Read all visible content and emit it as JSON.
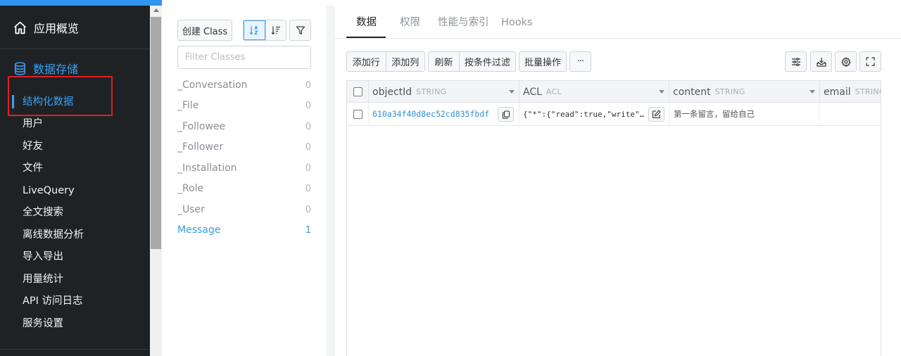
{
  "sidebar": {
    "header": {
      "label": "应用概览",
      "icon": "home-icon"
    },
    "section": {
      "label": "数据存储",
      "icon": "database-icon"
    },
    "items": [
      {
        "label": "结构化数据",
        "active": true
      },
      {
        "label": "用户"
      },
      {
        "label": "好友"
      },
      {
        "label": "文件"
      },
      {
        "label": "LiveQuery"
      },
      {
        "label": "全文搜索"
      },
      {
        "label": "离线数据分析"
      },
      {
        "label": "导入导出"
      },
      {
        "label": "用量统计"
      },
      {
        "label": "API 访问日志"
      },
      {
        "label": "服务设置"
      }
    ],
    "accent_color": "#3aa0f2",
    "highlight_color": "#e02020"
  },
  "class_panel": {
    "create_label": "创建 Class",
    "sort_asc_icon": "sort-alpha-icon",
    "sort_desc_icon": "sort-desc-icon",
    "filter_icon": "funnel-icon",
    "filter_placeholder": "Filter Classes",
    "classes": [
      {
        "name": "_Conversation",
        "count": "0"
      },
      {
        "name": "_File",
        "count": "0"
      },
      {
        "name": "_Followee",
        "count": "0"
      },
      {
        "name": "_Follower",
        "count": "0"
      },
      {
        "name": "_Installation",
        "count": "0"
      },
      {
        "name": "_Role",
        "count": "0"
      },
      {
        "name": "_User",
        "count": "0"
      },
      {
        "name": "Message",
        "count": "1",
        "selected": true
      }
    ]
  },
  "tabs": [
    {
      "label": "数据",
      "active": true
    },
    {
      "label": "权限"
    },
    {
      "label": "性能与索引"
    },
    {
      "label": "Hooks"
    }
  ],
  "toolbar": {
    "add_row": "添加行",
    "add_column": "添加列",
    "refresh": "刷新",
    "filter_by_condition": "按条件过滤",
    "batch_ops": "批量操作",
    "more": "···",
    "right_icons": [
      "columns-settings-icon",
      "download-icon",
      "gear-icon",
      "fullscreen-icon"
    ]
  },
  "table": {
    "columns": [
      {
        "name": "objectId",
        "type": "STRING"
      },
      {
        "name": "ACL",
        "type": "ACL"
      },
      {
        "name": "content",
        "type": "STRING"
      },
      {
        "name": "email",
        "type": "STRING"
      }
    ],
    "rows": [
      {
        "objectId": "610a34f40d8ec52cd835fbdf",
        "ACL": "{\"*\":{\"read\":true,\"write\"…",
        "content": "第一条留言，留给自己",
        "email": ""
      }
    ]
  }
}
